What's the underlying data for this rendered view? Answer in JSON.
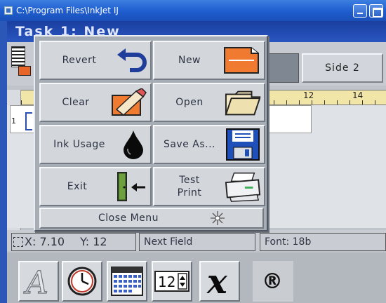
{
  "window": {
    "title": "C:\\Program Files\\InkJet   IJ"
  },
  "task_header": "Task 1: New",
  "toolbar": {
    "side_button": "Side 2"
  },
  "ruler": {
    "label_12": "12",
    "label_14": "14"
  },
  "editor": {
    "line_number": "1"
  },
  "status": {
    "x_label": "X: 7.10",
    "y_label": "Y: 12",
    "field": "Next Field",
    "font": "Font: 18b"
  },
  "menu": {
    "items": [
      {
        "label": "Revert",
        "icon": "undo-arrow-icon"
      },
      {
        "label": "New",
        "icon": "new-document-icon"
      },
      {
        "label": "Clear",
        "icon": "eraser-icon"
      },
      {
        "label": "Open",
        "icon": "folder-icon"
      },
      {
        "label": "Ink Usage",
        "icon": "ink-drop-icon"
      },
      {
        "label": "Save As...",
        "icon": "floppy-disk-icon"
      },
      {
        "label": "Exit",
        "icon": "exit-door-icon"
      },
      {
        "label": "Test\nPrint",
        "icon": "printer-icon"
      }
    ],
    "close_label": "Close Menu"
  },
  "palette": {
    "items": [
      "font-a-icon",
      "clock-icon",
      "calendar-icon",
      "counter-icon",
      "special-character-icon",
      "registered-icon"
    ],
    "counter_text": "12",
    "registered_text": "®",
    "script_x": "x",
    "font_a": "A"
  },
  "colors": {
    "titlebar": "#1f5fd0",
    "accent_orange": "#e8662a",
    "menu_face": "#d3d7dc"
  }
}
